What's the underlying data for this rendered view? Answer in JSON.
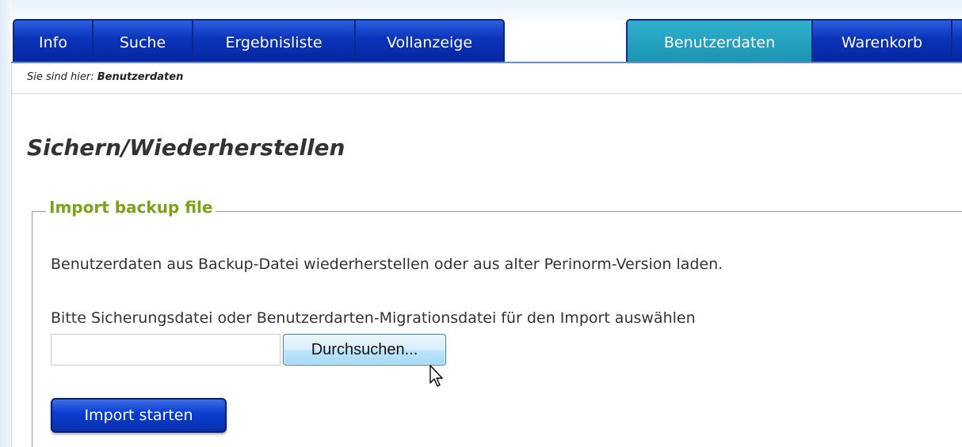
{
  "nav": {
    "left_tabs": [
      {
        "label": "Info"
      },
      {
        "label": "Suche"
      },
      {
        "label": "Ergebnisliste"
      },
      {
        "label": "Vollanzeige"
      }
    ],
    "right_tabs": [
      {
        "label": "Benutzerdaten",
        "active": true
      },
      {
        "label": "Warenkorb"
      }
    ]
  },
  "breadcrumb": {
    "prefix": "Sie sind hier:",
    "current": "Benutzerdaten"
  },
  "page": {
    "title": "Sichern/Wiederherstellen"
  },
  "import_section": {
    "legend": "Import backup file",
    "description": "Benutzerdaten aus Backup-Datei wiederherstellen oder aus alter Perinorm-Version laden.",
    "instruction": "Bitte Sicherungsdatei oder Benutzerdarten-Migrationsdatei für den Import auswählen",
    "file_input_value": "",
    "browse_label": "Durchsuchen...",
    "submit_label": "Import starten"
  },
  "colors": {
    "tab_blue": "#0a33b8",
    "tab_active": "#1a94b4",
    "legend_green": "#7aa415",
    "title_gray": "#333333"
  },
  "icons": {
    "cursor": "arrow-pointer-icon"
  }
}
